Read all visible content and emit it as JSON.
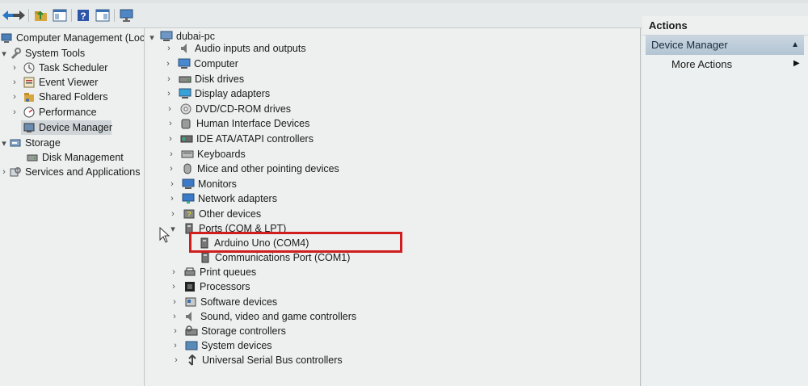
{
  "toolbar": {
    "buttons": [
      {
        "name": "back-button",
        "icon": "back-arrow-icon"
      },
      {
        "name": "forward-button",
        "icon": "forward-arrow-icon"
      },
      {
        "name": "up-folder-button",
        "icon": "up-folder-icon"
      },
      {
        "name": "show-hide-tree-button",
        "icon": "console-tree-icon"
      },
      {
        "name": "help-button",
        "icon": "help-icon"
      },
      {
        "name": "show-hide-action-pane-button",
        "icon": "action-pane-icon"
      },
      {
        "name": "scan-hardware-button",
        "icon": "monitor-scan-icon"
      }
    ]
  },
  "tree": {
    "root": "Computer Management (Local",
    "system_tools": "System Tools",
    "task_scheduler": "Task Scheduler",
    "event_viewer": "Event Viewer",
    "shared_folders": "Shared Folders",
    "performance": "Performance",
    "device_manager": "Device Manager",
    "storage": "Storage",
    "disk_management": "Disk Management",
    "services_apps": "Services and Applications"
  },
  "devices": {
    "host": "dubai-pc",
    "categories": [
      "Audio inputs and outputs",
      "Computer",
      "Disk drives",
      "Display adapters",
      "DVD/CD-ROM drives",
      "Human Interface Devices",
      "IDE ATA/ATAPI controllers",
      "Keyboards",
      "Mice and other pointing devices",
      "Monitors",
      "Network adapters",
      "Other devices",
      "Ports (COM & LPT)"
    ],
    "ports_children": [
      "Arduino Uno (COM4)",
      "Communications Port (COM1)"
    ],
    "categories_after": [
      "Print queues",
      "Processors",
      "Software devices",
      "Sound, video and game controllers",
      "Storage controllers",
      "System devices",
      "Universal Serial Bus controllers"
    ]
  },
  "actions": {
    "header": "Actions",
    "section": "Device Manager",
    "more_actions": "More Actions"
  },
  "colors": {
    "highlight": "#d01e1e",
    "section_header": "#b3c4d2"
  }
}
